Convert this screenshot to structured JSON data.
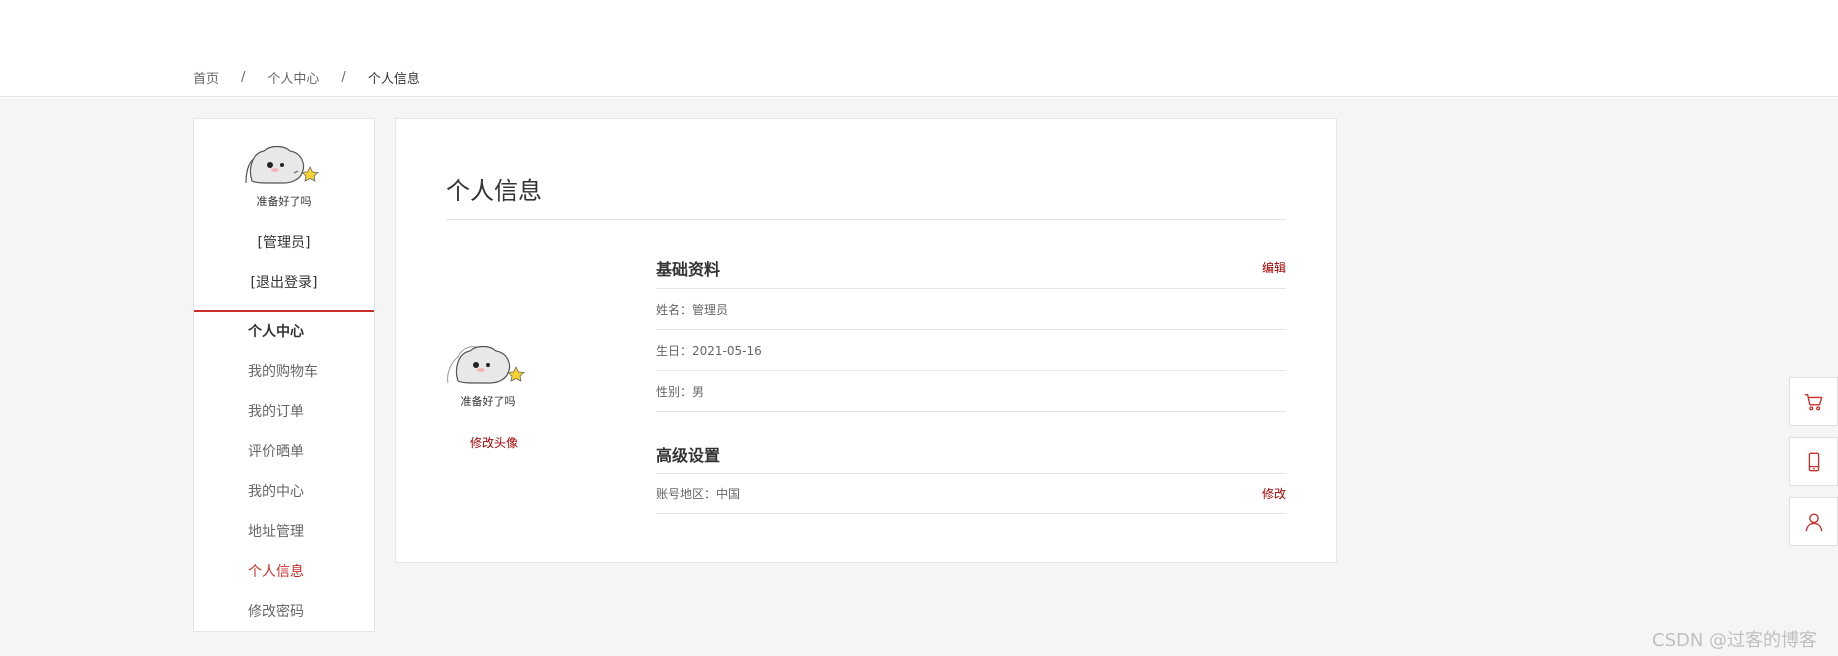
{
  "breadcrumb": {
    "home": "首页",
    "level2": "个人中心",
    "current": "个人信息",
    "separator": "/"
  },
  "sidebar": {
    "avatar_caption": "准备好了吗",
    "role": "[管理员]",
    "logout": "[退出登录]",
    "menu_title": "个人中心",
    "items": [
      {
        "label": "我的购物车"
      },
      {
        "label": "我的订单"
      },
      {
        "label": "评价晒单"
      },
      {
        "label": "我的中心"
      },
      {
        "label": "地址管理"
      },
      {
        "label": "个人信息"
      },
      {
        "label": "修改密码"
      }
    ],
    "active_item": "个人信息"
  },
  "panel": {
    "title": "个人信息",
    "avatar_caption": "准备好了吗",
    "change_avatar": "修改头像",
    "basic": {
      "heading": "基础资料",
      "action": "编辑",
      "name": "姓名：管理员",
      "birthday": "生日：2021-05-16",
      "gender": "性别：男"
    },
    "advanced": {
      "heading": "高级设置",
      "region": "账号地区：中国",
      "action": "修改"
    }
  },
  "float_toolbar": [
    "cart-icon",
    "phone-icon",
    "user-icon"
  ],
  "watermark": "CSDN @过客的博客",
  "colors": {
    "accent": "#a40000",
    "accent_border": "#c9302c",
    "background": "#f5f5f5"
  }
}
